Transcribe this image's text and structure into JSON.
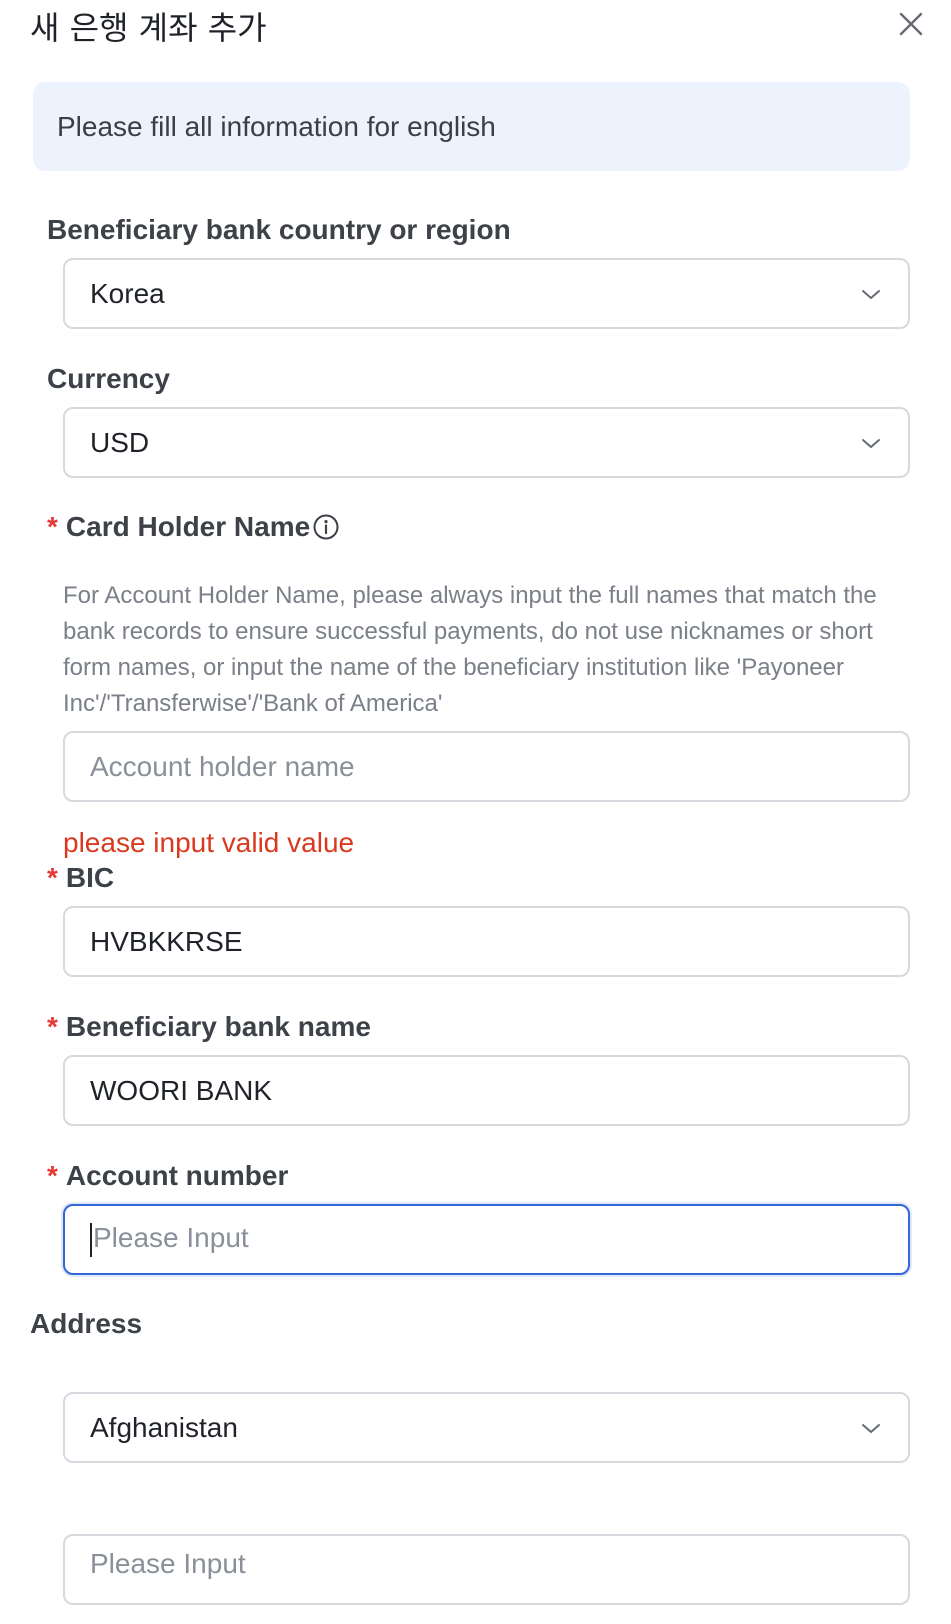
{
  "modal": {
    "title": "새 은행 계좌 추가",
    "close_icon": "close-icon"
  },
  "notice": "Please fill all information for english",
  "form": {
    "country": {
      "label": "Beneficiary bank country or region",
      "value": "Korea"
    },
    "currency": {
      "label": "Currency",
      "value": "USD"
    },
    "card_holder": {
      "required_mark": "*",
      "label": "Card Holder Name",
      "help": "For Account Holder Name, please always input the full names that match the bank records to ensure successful payments, do not use nicknames or short form names, or input the name of the beneficiary institution like 'Payoneer Inc'/'Transferwise'/'Bank of America'",
      "placeholder": "Account holder name",
      "value": "",
      "error": "please input valid value"
    },
    "bic": {
      "required_mark": "*",
      "label": "BIC",
      "value": "HVBKKRSE"
    },
    "bank_name": {
      "required_mark": "*",
      "label": "Beneficiary bank name",
      "value": "WOORI BANK"
    },
    "account_number": {
      "required_mark": "*",
      "label": "Account number",
      "placeholder": "Please Input",
      "value": ""
    },
    "address": {
      "label": "Address",
      "country_value": "Afghanistan",
      "line_placeholder": "Please Input"
    }
  },
  "colors": {
    "required": "#e53935",
    "error": "#d93a1f",
    "focus_border": "#3367d6",
    "notice_bg": "#edf3fd"
  }
}
